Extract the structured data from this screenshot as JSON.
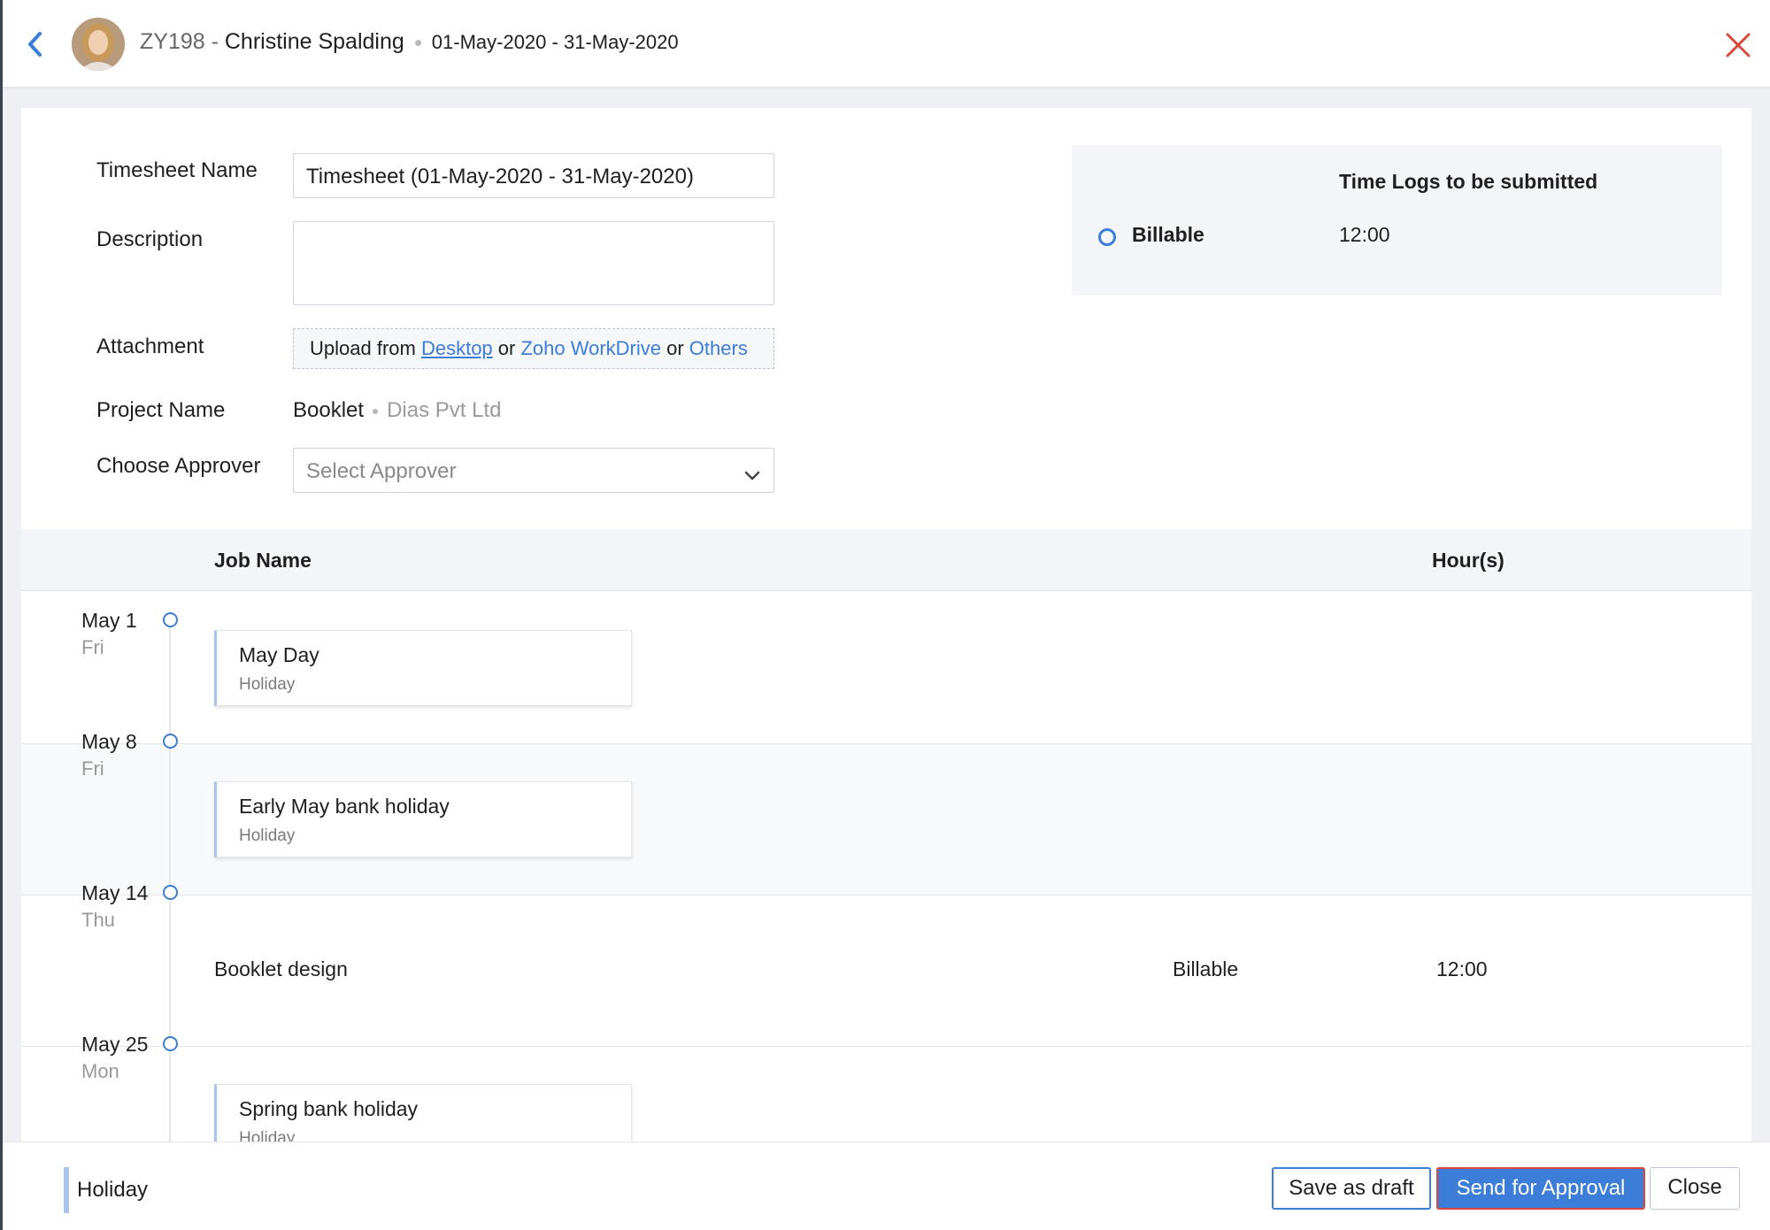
{
  "header": {
    "employee_code": "ZY198 - ",
    "employee_name": "Christine Spalding",
    "period": "01-May-2020 - 31-May-2020"
  },
  "form": {
    "timesheet_name_label": "Timesheet Name",
    "timesheet_name_value": "Timesheet (01-May-2020 - 31-May-2020)",
    "description_label": "Description",
    "description_value": "",
    "attachment_label": "Attachment",
    "upload_prefix": "Upload from ",
    "upload_desktop": "Desktop",
    "upload_or1": " or ",
    "upload_workdrive": "Zoho WorkDrive",
    "upload_or2": " or ",
    "upload_others": "Others",
    "project_label": "Project Name",
    "project_name": "Booklet",
    "project_client": "Dias Pvt Ltd",
    "approver_label": "Choose Approver",
    "approver_placeholder": "Select Approver"
  },
  "summary": {
    "title": "Time Logs to be submitted",
    "type_label": "Billable",
    "type_value": "12:00"
  },
  "table": {
    "col_job": "Job Name",
    "col_hours": "Hour(s)"
  },
  "entries": [
    {
      "date": "May 1",
      "day": "Fri",
      "holiday_name": "May Day",
      "holiday_type": "Holiday"
    },
    {
      "date": "May 8",
      "day": "Fri",
      "holiday_name": "Early May bank holiday",
      "holiday_type": "Holiday"
    },
    {
      "date": "May 14",
      "day": "Thu",
      "job_name": "Booklet design",
      "billing": "Billable",
      "hours": "12:00"
    },
    {
      "date": "May 25",
      "day": "Mon",
      "holiday_name": "Spring bank holiday",
      "holiday_type": "Holiday"
    }
  ],
  "footer": {
    "legend": "Holiday",
    "save_draft": "Save as draft",
    "send_approval": "Send for Approval",
    "close": "Close"
  },
  "colors": {
    "accent": "#3b7dd8",
    "close_icon": "#d9483b",
    "holiday_marker": "#a9c4e8"
  },
  "icons": [
    "back-arrow-icon",
    "close-icon",
    "chevron-down-icon",
    "timeline-ring-icon"
  ]
}
